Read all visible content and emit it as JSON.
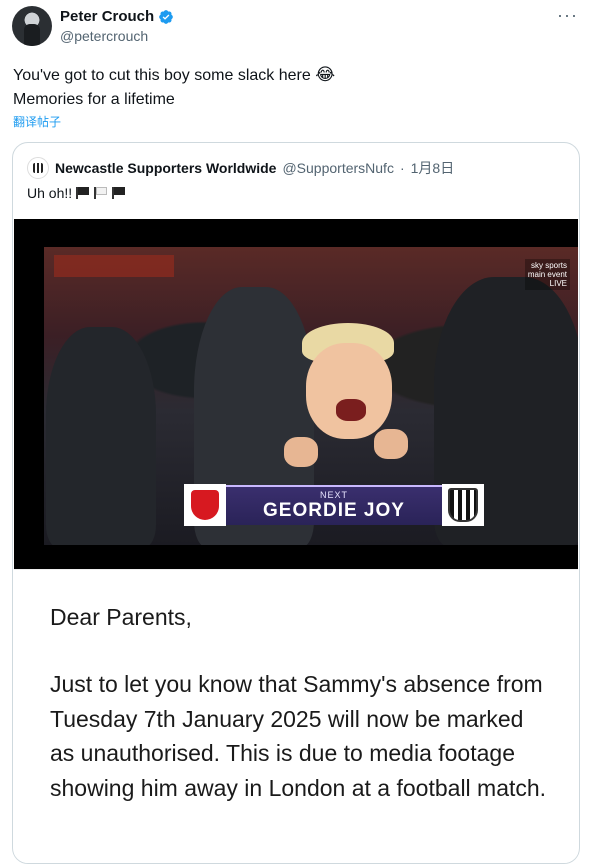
{
  "tweet": {
    "author_name": "Peter Crouch",
    "author_handle": "@petercrouch",
    "more_label": "···",
    "line1": "You've got to cut this boy some slack here",
    "line1_emoji": "😂",
    "line2": "Memories for a lifetime",
    "translate_label": "翻译帖子"
  },
  "quote": {
    "author_name": "Newcastle Supporters Worldwide",
    "author_handle": "@SupportersNufc",
    "separator": "·",
    "date": "1月8日",
    "text": "Uh oh!!",
    "flags": [
      "black-flag",
      "white-flag",
      "black-flag"
    ]
  },
  "media": {
    "broadcast": {
      "next_label": "NEXT",
      "title": "GEORDIE JOY",
      "badge_line1": "sky sports",
      "badge_line2": "main event",
      "badge_line3": "LIVE"
    },
    "letter": {
      "greeting": "Dear Parents,",
      "body": "Just to let you know that Sammy's absence from Tuesday 7th January 2025 will now be marked as unauthorised. This is due to media footage showing him away in London at a football match."
    }
  },
  "colors": {
    "accent": "#1d9bf0",
    "text": "#0f1419",
    "muted": "#536471",
    "border": "#cfd9de"
  }
}
